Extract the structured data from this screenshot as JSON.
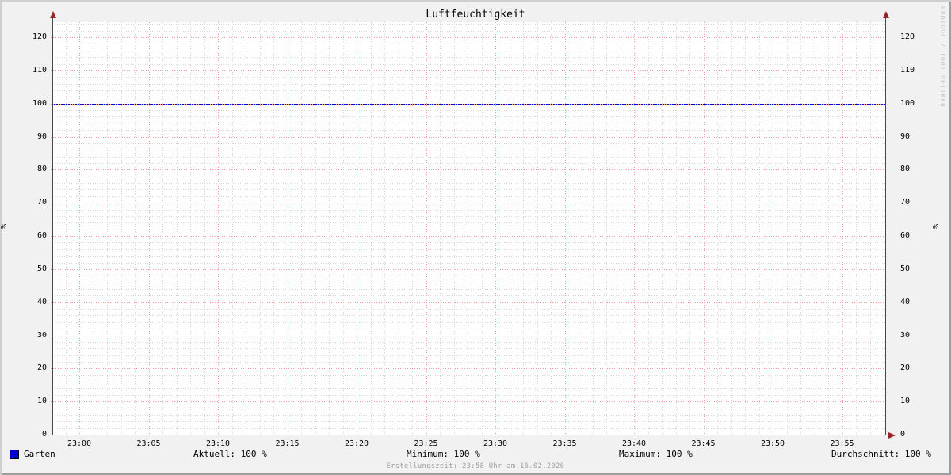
{
  "title": "Luftfeuchtigkeit",
  "watermark": "RRDTOOL / TOBI OETIKER",
  "y_axis": {
    "unit": "%",
    "ticks": [
      "0",
      "10",
      "20",
      "30",
      "40",
      "50",
      "60",
      "70",
      "80",
      "90",
      "100",
      "110",
      "120"
    ]
  },
  "x_axis": {
    "ticks": [
      "23:00",
      "23:05",
      "23:10",
      "23:15",
      "23:20",
      "23:25",
      "23:30",
      "23:35",
      "23:40",
      "23:45",
      "23:50",
      "23:55"
    ]
  },
  "legend": {
    "series_label": "Garten",
    "series_color": "#0000cc",
    "stats": {
      "aktuell": "Aktuell: 100 %",
      "minimum": "Minimum: 100 %",
      "maximum": "Maximum: 100 %",
      "durchschnitt": "Durchschnitt: 100 %"
    }
  },
  "footer": "Erstellungszeit: 23:58 Uhr am 16.02.2026",
  "colors": {
    "background": "#f1f1f1",
    "canvas": "#ffffff",
    "grid_minor": "#d4d4d4",
    "grid_major": "#ee9c9c",
    "axis": "#474747",
    "arrow": "#992222",
    "series": "#0000cc",
    "watermark": "#c6c6c6",
    "footer_text": "#9c9c9c"
  },
  "chart_data": {
    "type": "line",
    "title": "Luftfeuchtigkeit",
    "ylabel": "%",
    "ylim": [
      0,
      125
    ],
    "yticks": [
      0,
      10,
      20,
      30,
      40,
      50,
      60,
      70,
      80,
      90,
      100,
      110,
      120
    ],
    "x": [
      "23:00",
      "23:05",
      "23:10",
      "23:15",
      "23:20",
      "23:25",
      "23:30",
      "23:35",
      "23:40",
      "23:45",
      "23:50",
      "23:55"
    ],
    "grid": true,
    "legend_position": "bottom",
    "series": [
      {
        "name": "Garten",
        "color": "#0000cc",
        "values": [
          100,
          100,
          100,
          100,
          100,
          100,
          100,
          100,
          100,
          100,
          100,
          100
        ],
        "aktuell": 100,
        "minimum": 100,
        "maximum": 100,
        "durchschnitt": 100
      }
    ]
  }
}
